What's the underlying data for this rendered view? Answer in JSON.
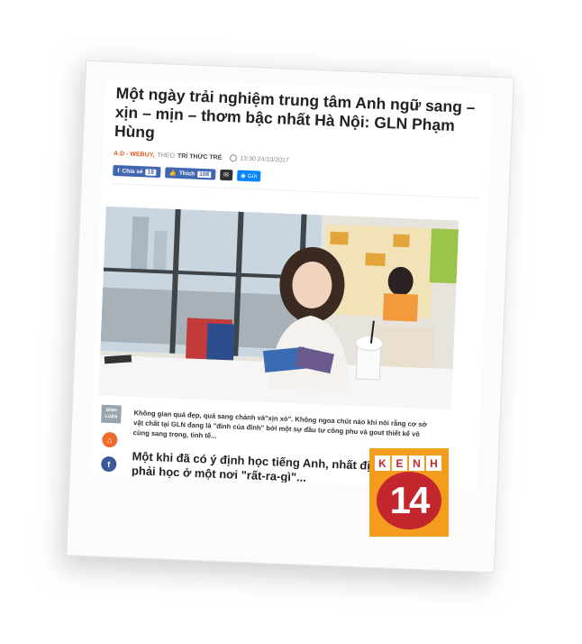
{
  "article": {
    "title": "Một ngày trải nghiệm trung tâm Anh ngữ sang – xịn – mịn – thơm bậc nhất Hà Nội: GLN Phạm Hùng",
    "author": "A.D - WEBUY,",
    "source_prefix": "THEO",
    "source": "TRÍ THỨC TRẺ",
    "timestamp": "13:30 24/10/2017"
  },
  "social": {
    "share_label": "Chia sẻ",
    "share_count": "18",
    "like_label": "Thích",
    "like_count": "108",
    "mail_icon": "✉",
    "send_label": "Gửi"
  },
  "sidebar": {
    "comment_label": "BÌNH LUẬN",
    "home_icon": "⌂",
    "facebook_icon": "f"
  },
  "caption": "Không gian quá đẹp, quá sang chảnh và\"xịn xò\". Không ngoa chút nào khi nói rằng cơ sở vật chất tại GLN đang là \"đỉnh của đỉnh\" bởi một sự đầu tư công phu và gout thiết kế vô cùng sang trọng, tinh tế...",
  "subheading": "Một khi đã có ý định học tiếng Anh, nhất định phải học ở một nơi \"rất-ra-gì\"...",
  "logo": {
    "letters": [
      "K",
      "E",
      "N",
      "H"
    ],
    "number": "14"
  },
  "colors": {
    "facebook_blue": "#4267b2",
    "messenger_blue": "#0084ff",
    "author_orange": "#e05a1b",
    "logo_orange": "#f39c1e",
    "logo_red": "#c4262e"
  }
}
